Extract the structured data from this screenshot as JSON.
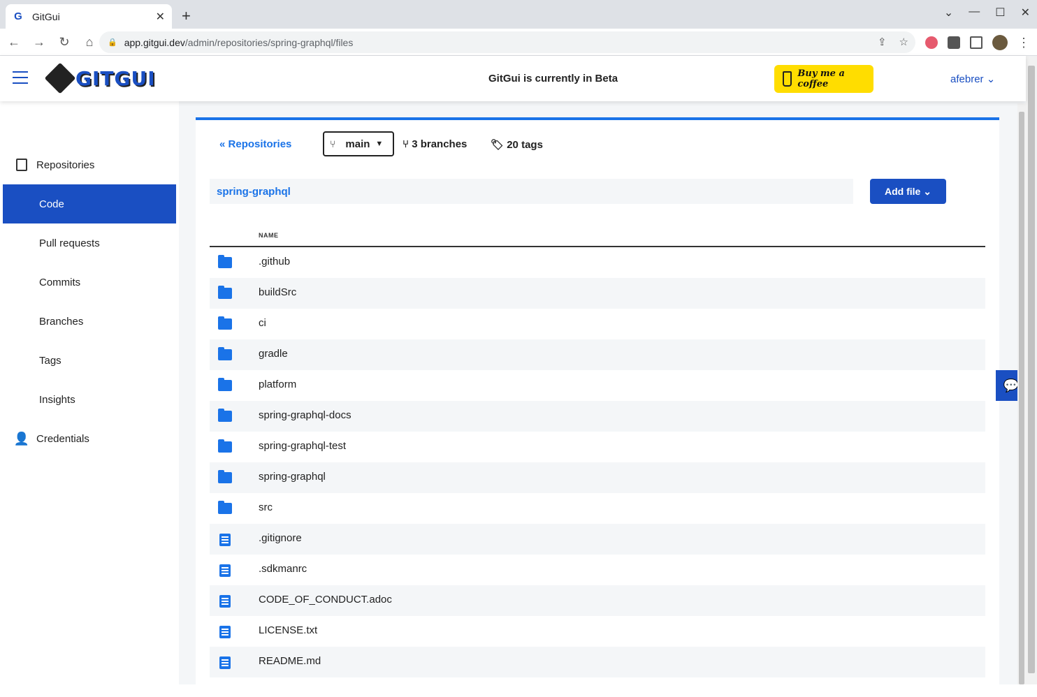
{
  "browser": {
    "tab_title": "GitGui",
    "url_host": "app.gitgui.dev",
    "url_path": "/admin/repositories/spring-graphql/files"
  },
  "header": {
    "logo_text": "GITGUI",
    "beta_notice": "GitGui is currently in Beta",
    "coffee_label": "Buy me a coffee",
    "user_name": "afebrer"
  },
  "sidebar": {
    "items": [
      {
        "label": "Repositories"
      },
      {
        "label": "Code"
      },
      {
        "label": "Pull requests"
      },
      {
        "label": "Commits"
      },
      {
        "label": "Branches"
      },
      {
        "label": "Tags"
      },
      {
        "label": "Insights"
      },
      {
        "label": "Credentials"
      }
    ]
  },
  "repo": {
    "back_label": "Repositories",
    "branch": "main",
    "branches_count": "3 branches",
    "tags_count": "20 tags",
    "path": "spring-graphql",
    "add_file_label": "Add file"
  },
  "files": {
    "column_header": "NAME",
    "rows": [
      {
        "name": ".github",
        "type": "folder"
      },
      {
        "name": "buildSrc",
        "type": "folder"
      },
      {
        "name": "ci",
        "type": "folder"
      },
      {
        "name": "gradle",
        "type": "folder"
      },
      {
        "name": "platform",
        "type": "folder"
      },
      {
        "name": "spring-graphql-docs",
        "type": "folder"
      },
      {
        "name": "spring-graphql-test",
        "type": "folder"
      },
      {
        "name": "spring-graphql",
        "type": "folder"
      },
      {
        "name": "src",
        "type": "folder"
      },
      {
        "name": ".gitignore",
        "type": "file"
      },
      {
        "name": ".sdkmanrc",
        "type": "file"
      },
      {
        "name": "CODE_OF_CONDUCT.adoc",
        "type": "file"
      },
      {
        "name": "LICENSE.txt",
        "type": "file"
      },
      {
        "name": "README.md",
        "type": "file"
      }
    ]
  }
}
